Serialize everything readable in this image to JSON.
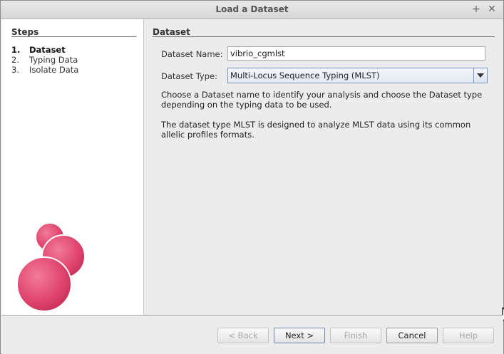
{
  "window": {
    "title": "Load a Dataset",
    "maximize_icon": "+",
    "close_icon": "✕"
  },
  "sidebar": {
    "title": "Steps",
    "steps": [
      {
        "num": "1.",
        "label": "Dataset"
      },
      {
        "num": "2.",
        "label": "Typing Data"
      },
      {
        "num": "3.",
        "label": "Isolate Data"
      }
    ]
  },
  "main": {
    "section_title": "Dataset",
    "name_label": "Dataset Name:",
    "name_value": "vibrio_cgmlst",
    "type_label": "Dataset Type:",
    "type_value": "Multi-Locus Sequence Typing (MLST)",
    "para1": "Choose a Dataset name to identify your analysis and choose the Dataset type depending on the typing data to be used.",
    "para2": "The dataset type MLST is designed to analyze MLST data using its common allelic profiles formats."
  },
  "buttons": {
    "back": "< Back",
    "next": "Next >",
    "finish": "Finish",
    "cancel": "Cancel",
    "help": "Help"
  },
  "colors": {
    "logo": "#e0466e",
    "accent": "#7c94b5"
  }
}
